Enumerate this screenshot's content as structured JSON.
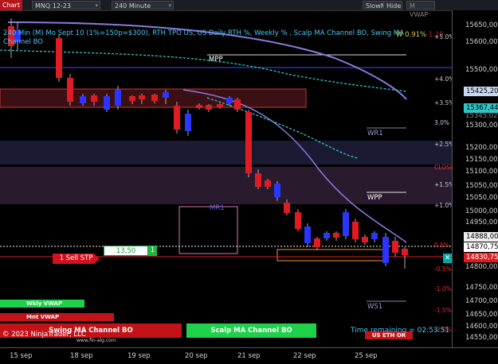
{
  "toolbar": {
    "chart_tab": "Chart",
    "instrument": "MNQ 12-23",
    "interval": "240 Minute",
    "indicator_select": "SlowMA",
    "hide_label": "Hide",
    "m_vwap_label": "M VWAP"
  },
  "header": {
    "line1": "240 Min (M) Mo Sept 10 (1%=150p=$300), RTH TPO US, US Daily RTH %, Weekly % , Scalp MA Channel BO, Swing MA",
    "line2": "Channel BO",
    "w_vol": "W 0.91%",
    "w_vol_extra": "1.25"
  },
  "levels": {
    "mpp": "MPP",
    "wr1": "WR1",
    "wpp": "WPP",
    "ws1": "WS1",
    "mr1": "MR1",
    "ms1": "MS1"
  },
  "pct_labels": [
    {
      "text": "+5.0%",
      "red": false
    },
    {
      "text": "+4.0%",
      "red": false
    },
    {
      "text": "+3.5%",
      "red": false
    },
    {
      "text": "3.0%",
      "red": false
    },
    {
      "text": "+2.5%",
      "red": false
    },
    {
      "text": "CLOSE",
      "red": true
    },
    {
      "text": "+1.5%",
      "red": false
    },
    {
      "text": "+1.0%",
      "red": false
    },
    {
      "text": "0.5%",
      "red": true
    },
    {
      "text": "-0.5%",
      "red": true
    },
    {
      "text": "-1.0%",
      "red": true
    },
    {
      "text": "-1.5%",
      "red": true
    },
    {
      "text": "-2.0%",
      "red": true
    }
  ],
  "price_axis": {
    "ticks": [
      "15600,00",
      "15500,00",
      "15400,00",
      "15300,00",
      "15200,00",
      "15150,00",
      "15100,00",
      "15050,00",
      "15000,00",
      "14950,00",
      "14900,00",
      "14800,00",
      "14750,00",
      "14700,00",
      "14650,00",
      "14600,00",
      "14550,00",
      "14500,00"
    ],
    "top_tick": "15650,00",
    "tag_last_price": "15425,20",
    "tag_vwap": "15367,44",
    "tag_below_vwap": "15345,02",
    "tag_current": "14870,75",
    "tag_order": "14830,75",
    "tag_hidden": "14888,00"
  },
  "x_axis": [
    "15 sep",
    "18 sep",
    "19 sep",
    "20 sep",
    "21 sep",
    "22 sep",
    "25 sep"
  ],
  "order": {
    "label": "1 Sell STP",
    "quantity": "13,50",
    "qty_button": "1"
  },
  "bottom": {
    "wkly_vwap": "Wkly VWAP",
    "mnt_vwap": "Mnt VWAP",
    "swing": "Swing MA Channel BO",
    "scalp": "Scalp MA Channel BO",
    "time_remaining": "Time remaining = 02:53:51",
    "us_eth_or": "US ETH OR",
    "copyright": "© 2023 NinjaTrader, LLC",
    "website": "www.fin-alg.com"
  },
  "colors": {
    "bull": "#2a35ff",
    "bear": "#e01b22",
    "accent": "#b6151c",
    "scalp_green": "#1fd14a",
    "swing_red": "#c41219"
  }
}
